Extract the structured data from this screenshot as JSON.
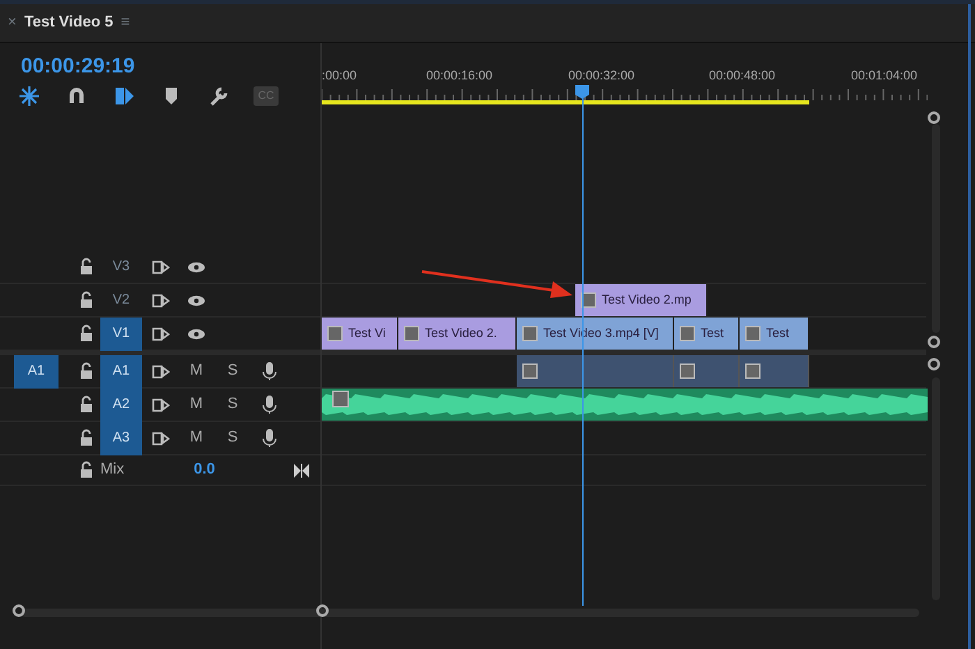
{
  "panel": {
    "close": "×",
    "title": "Test Video 5",
    "menu": "≡",
    "timecode": "00:00:29:19"
  },
  "toolbar": [
    {
      "kind": "nest",
      "on": true
    },
    {
      "kind": "snap",
      "on": false
    },
    {
      "kind": "link",
      "on": true
    },
    {
      "kind": "marker",
      "on": false
    },
    {
      "kind": "wrench",
      "on": false
    },
    {
      "kind": "cc",
      "on": false,
      "label": "CC"
    }
  ],
  "ruler": {
    "labels": [
      ":00:00",
      "00:00:16:00",
      "00:00:32:00",
      "00:00:48:00",
      "00:01:04:00"
    ],
    "work_area": true
  },
  "video_tracks": [
    {
      "label": "V3",
      "targeted": false
    },
    {
      "label": "V2",
      "targeted": false,
      "clips": [
        {
          "name": "Test Video 2.mp",
          "selected": false
        }
      ]
    },
    {
      "label": "V1",
      "targeted": true,
      "clips": [
        {
          "name": "Test Vi",
          "selected": false
        },
        {
          "name": "Test Video 2.",
          "selected": false
        },
        {
          "name": "Test Video 3.mp4 [V]",
          "selected": true
        },
        {
          "name": "Test",
          "selected": true
        },
        {
          "name": "Test",
          "selected": true
        }
      ]
    }
  ],
  "audio_tracks": [
    {
      "source": "A1",
      "label": "A1",
      "targeted": true,
      "mute": "M",
      "solo": "S",
      "clips": [
        {
          "kind": "linked"
        },
        {
          "kind": "linked"
        },
        {
          "kind": "linked"
        }
      ]
    },
    {
      "label": "A2",
      "targeted": true,
      "mute": "M",
      "solo": "S",
      "clips": [
        {
          "kind": "waveform"
        }
      ]
    },
    {
      "label": "A3",
      "targeted": true,
      "mute": "M",
      "solo": "S"
    }
  ],
  "mix": {
    "label": "Mix",
    "value": "0.0"
  },
  "annotation": {
    "kind": "arrow",
    "color": "#e0301e"
  }
}
